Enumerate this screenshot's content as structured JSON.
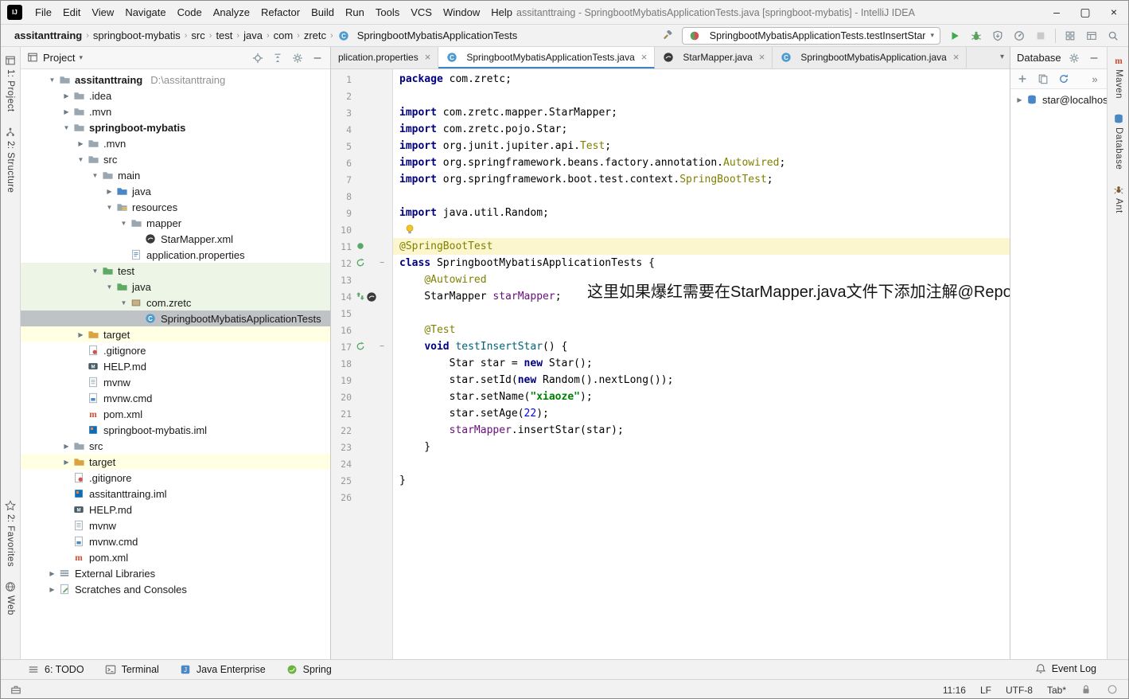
{
  "window": {
    "title": "assitanttraing - SpringbootMybatisApplicationTests.java [springboot-mybatis] - IntelliJ IDEA",
    "menus": [
      "File",
      "Edit",
      "View",
      "Navigate",
      "Code",
      "Analyze",
      "Refactor",
      "Build",
      "Run",
      "Tools",
      "VCS",
      "Window",
      "Help"
    ]
  },
  "navbar": {
    "breadcrumbs": [
      "assitanttraing",
      "springboot-mybatis",
      "src",
      "test",
      "java",
      "com",
      "zretc"
    ],
    "file_crumb": "SpringbootMybatisApplicationTests",
    "run_config": "SpringbootMybatisApplicationTests.testInsertStar"
  },
  "stripes": {
    "left_top": [
      {
        "label": "1: Project",
        "icon": "project"
      },
      {
        "label": "2: Structure",
        "icon": "structure"
      }
    ],
    "left_bottom": [
      {
        "label": "2: Favorites",
        "icon": "favorites"
      },
      {
        "label": "Web",
        "icon": "web"
      }
    ],
    "right": [
      {
        "label": "Maven",
        "icon": "maven"
      },
      {
        "label": "Database",
        "icon": "db"
      },
      {
        "label": "Ant",
        "icon": "ant"
      }
    ]
  },
  "project": {
    "header": "Project",
    "tree": [
      {
        "label": "assitanttraing",
        "suffix": "D:\\assitanttraing",
        "level": 0,
        "icon": "folder",
        "chev": "v",
        "bold": true
      },
      {
        "label": ".idea",
        "level": 1,
        "icon": "folder",
        "chev": ">"
      },
      {
        "label": ".mvn",
        "level": 1,
        "icon": "folder",
        "chev": ">"
      },
      {
        "label": "springboot-mybatis",
        "level": 1,
        "icon": "folder",
        "chev": "v",
        "bold": true
      },
      {
        "label": ".mvn",
        "level": 2,
        "icon": "folder",
        "chev": ">"
      },
      {
        "label": "src",
        "level": 2,
        "icon": "folder",
        "chev": "v"
      },
      {
        "label": "main",
        "level": 3,
        "icon": "folder",
        "chev": "v"
      },
      {
        "label": "java",
        "level": 4,
        "icon": "folder-src",
        "chev": ">"
      },
      {
        "label": "resources",
        "level": 4,
        "icon": "folder-res",
        "chev": "v"
      },
      {
        "label": "mapper",
        "level": 5,
        "icon": "folder",
        "chev": "v"
      },
      {
        "label": "StarMapper.xml",
        "level": 6,
        "icon": "mybatis"
      },
      {
        "label": "application.properties",
        "level": 5,
        "icon": "properties"
      },
      {
        "label": "test",
        "level": 3,
        "icon": "folder-test",
        "chev": "v",
        "bg": "green"
      },
      {
        "label": "java",
        "level": 4,
        "icon": "folder-test",
        "chev": "v",
        "bg": "green"
      },
      {
        "label": "com.zretc",
        "level": 5,
        "icon": "package",
        "chev": "v",
        "bg": "green"
      },
      {
        "label": "SpringbootMybatisApplicationTests",
        "level": 6,
        "icon": "class",
        "selected": true
      },
      {
        "label": "target",
        "level": 2,
        "icon": "folder-excluded",
        "chev": ">",
        "bg": "yellow"
      },
      {
        "label": ".gitignore",
        "level": 2,
        "icon": "gitignore"
      },
      {
        "label": "HELP.md",
        "level": 2,
        "icon": "markdown"
      },
      {
        "label": "mvnw",
        "level": 2,
        "icon": "textfile"
      },
      {
        "label": "mvnw.cmd",
        "level": 2,
        "icon": "cmdfile"
      },
      {
        "label": "pom.xml",
        "level": 2,
        "icon": "maven"
      },
      {
        "label": "springboot-mybatis.iml",
        "level": 2,
        "icon": "iml"
      },
      {
        "label": "src",
        "level": 1,
        "icon": "folder",
        "chev": ">"
      },
      {
        "label": "target",
        "level": 1,
        "icon": "folder-excluded",
        "chev": ">",
        "bg": "yellow"
      },
      {
        "label": ".gitignore",
        "level": 1,
        "icon": "gitignore"
      },
      {
        "label": "assitanttraing.iml",
        "level": 1,
        "icon": "iml"
      },
      {
        "label": "HELP.md",
        "level": 1,
        "icon": "markdown"
      },
      {
        "label": "mvnw",
        "level": 1,
        "icon": "textfile"
      },
      {
        "label": "mvnw.cmd",
        "level": 1,
        "icon": "cmdfile"
      },
      {
        "label": "pom.xml",
        "level": 1,
        "icon": "maven"
      },
      {
        "label": "External Libraries",
        "level": 0,
        "icon": "lib",
        "chev": ">"
      },
      {
        "label": "Scratches and Consoles",
        "level": 0,
        "icon": "scratch",
        "chev": ">"
      }
    ]
  },
  "editor": {
    "tabs": [
      {
        "label": "plication.properties",
        "icon": null,
        "active": false
      },
      {
        "label": "SpringbootMybatisApplicationTests.java",
        "icon": "class",
        "active": true
      },
      {
        "label": "StarMapper.java",
        "icon": "mybatis",
        "active": false
      },
      {
        "label": "SpringbootMybatisApplication.java",
        "icon": "class",
        "active": false
      }
    ],
    "note": "这里如果爆红需要在StarMapper.java文件下添加注解@Repository",
    "lines": [
      {
        "n": 1,
        "t": [
          [
            "kw",
            "package"
          ],
          [
            "pln",
            " com.zretc;"
          ]
        ]
      },
      {
        "n": 2,
        "t": []
      },
      {
        "n": 3,
        "t": [
          [
            "kw",
            "import"
          ],
          [
            "pln",
            " com.zretc.mapper.StarMapper;"
          ]
        ]
      },
      {
        "n": 4,
        "t": [
          [
            "kw",
            "import"
          ],
          [
            "pln",
            " com.zretc.pojo.Star;"
          ]
        ]
      },
      {
        "n": 5,
        "t": [
          [
            "kw",
            "import"
          ],
          [
            "pln",
            " org.junit.jupiter.api."
          ],
          [
            "ann",
            "Test"
          ],
          [
            "pln",
            ";"
          ]
        ]
      },
      {
        "n": 6,
        "t": [
          [
            "kw",
            "import"
          ],
          [
            "pln",
            " org.springframework.beans.factory.annotation."
          ],
          [
            "ann",
            "Autowired"
          ],
          [
            "pln",
            ";"
          ]
        ]
      },
      {
        "n": 7,
        "t": [
          [
            "kw",
            "import"
          ],
          [
            "pln",
            " org.springframework.boot.test.context."
          ],
          [
            "ann",
            "SpringBootTest"
          ],
          [
            "pln",
            ";"
          ]
        ]
      },
      {
        "n": 8,
        "t": []
      },
      {
        "n": 9,
        "t": [
          [
            "kw",
            "import"
          ],
          [
            "pln",
            " java.util.Random;"
          ]
        ]
      },
      {
        "n": 10,
        "t": [],
        "bulb": true
      },
      {
        "n": 11,
        "t": [
          [
            "ann",
            "@SpringBootTest"
          ]
        ],
        "hl": true,
        "gicons": [
          "run-dot"
        ]
      },
      {
        "n": 12,
        "t": [
          [
            "kw",
            "class"
          ],
          [
            "pln",
            " SpringbootMybatisApplicationTests {"
          ]
        ],
        "gicons": [
          "run-cycle"
        ],
        "fold": true
      },
      {
        "n": 13,
        "t": [
          [
            "pln",
            "    "
          ],
          [
            "ann",
            "@Autowired"
          ]
        ]
      },
      {
        "n": 14,
        "t": [
          [
            "pln",
            "    StarMapper "
          ],
          [
            "fld",
            "starMapper"
          ],
          [
            "pln",
            ";"
          ]
        ],
        "gicons": [
          "nav-arrows",
          "mybatis"
        ]
      },
      {
        "n": 15,
        "t": []
      },
      {
        "n": 16,
        "t": [
          [
            "pln",
            "    "
          ],
          [
            "ann",
            "@Test"
          ]
        ]
      },
      {
        "n": 17,
        "t": [
          [
            "pln",
            "    "
          ],
          [
            "kw",
            "void"
          ],
          [
            "pln",
            " "
          ],
          [
            "mth",
            "testInsertStar"
          ],
          [
            "pln",
            "() {"
          ]
        ],
        "gicons": [
          "run-cycle"
        ],
        "fold": true
      },
      {
        "n": 18,
        "t": [
          [
            "pln",
            "        Star star = "
          ],
          [
            "kw",
            "new"
          ],
          [
            "pln",
            " Star();"
          ]
        ]
      },
      {
        "n": 19,
        "t": [
          [
            "pln",
            "        star.setId("
          ],
          [
            "kw",
            "new"
          ],
          [
            "pln",
            " Random().nextLong());"
          ]
        ]
      },
      {
        "n": 20,
        "t": [
          [
            "pln",
            "        star.setName("
          ],
          [
            "str",
            "\"xiaoze\""
          ],
          [
            "pln",
            ");"
          ]
        ]
      },
      {
        "n": 21,
        "t": [
          [
            "pln",
            "        star.setAge("
          ],
          [
            "num",
            "22"
          ],
          [
            "pln",
            ");"
          ]
        ]
      },
      {
        "n": 22,
        "t": [
          [
            "pln",
            "        "
          ],
          [
            "fld",
            "starMapper"
          ],
          [
            "pln",
            ".insertStar(star);"
          ]
        ]
      },
      {
        "n": 23,
        "t": [
          [
            "pln",
            "    }"
          ]
        ]
      },
      {
        "n": 24,
        "t": []
      },
      {
        "n": 25,
        "t": [
          [
            "pln",
            "}"
          ]
        ]
      },
      {
        "n": 26,
        "t": []
      }
    ]
  },
  "database": {
    "header": "Database",
    "items": [
      {
        "label": "star@localhos",
        "icon": "db"
      }
    ]
  },
  "bottom_bar": {
    "left": [
      {
        "icon": "hamburger",
        "label": "6: TODO"
      },
      {
        "icon": "terminal",
        "label": "Terminal"
      },
      {
        "icon": "java-ee",
        "label": "Java Enterprise"
      },
      {
        "icon": "spring",
        "label": "Spring"
      }
    ],
    "right": {
      "icon": "event-log",
      "label": "Event Log"
    }
  },
  "status_bar": {
    "position": "11:16",
    "line_separator": "LF",
    "encoding": "UTF-8",
    "indent": "Tab*"
  },
  "colors": {
    "accent_blue": "#4083c9",
    "keyword": "#000080",
    "annotation": "#808000",
    "string": "#008000",
    "number": "#0000ff",
    "field": "#660e7a",
    "method": "#00627a",
    "caret_line_bg": "#fcf6ce",
    "test_scope_bg": "#edf5e6",
    "excluded_scope_bg": "#ffffe4",
    "selection_bg": "#c0c3c6",
    "run_green": "#3faa4d",
    "maven_red": "#cb4e33",
    "spring_green": "#6db33f"
  }
}
